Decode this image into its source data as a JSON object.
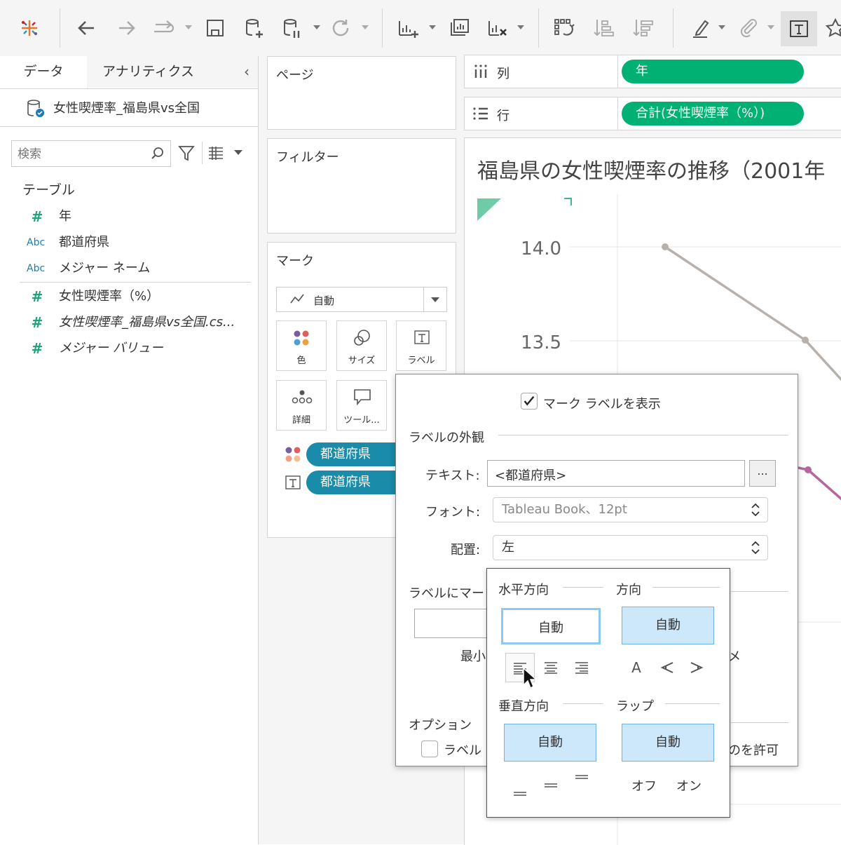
{
  "toolbar": {
    "icons": [
      "tableau-logo-icon",
      "back-icon",
      "forward-icon",
      "redo-icon",
      "save-icon",
      "new-datasource-icon",
      "pause-update-icon",
      "refresh-icon",
      "new-sheet-icon",
      "duplicate-sheet-icon",
      "clear-sheet-icon",
      "swap-icon",
      "sort-asc-icon",
      "sort-desc-icon",
      "highlight-icon",
      "attach-icon",
      "show-labels-icon",
      "pin-icon"
    ]
  },
  "datapane": {
    "tab_data": "データ",
    "tab_analytics": "アナリティクス",
    "datasource": "女性喫煙率_福島県vs全国",
    "search_placeholder": "検索",
    "section_table": "テーブル",
    "fields": [
      {
        "type": "#",
        "name": "年"
      },
      {
        "type": "Abc",
        "name": "都道府県"
      },
      {
        "type": "Abc",
        "name": "メジャー ネーム"
      },
      {
        "type": "#",
        "name": "女性喫煙率（%）"
      },
      {
        "type": "#",
        "name": "女性喫煙率_福島県vs全国.cs..."
      },
      {
        "type": "#",
        "name": "メジャー バリュー"
      }
    ]
  },
  "shelves": {
    "pages": "ページ",
    "filters": "フィルター",
    "marks": "マーク",
    "mark_type": "自動",
    "mark_buttons": [
      "色",
      "サイズ",
      "ラベル",
      "詳細",
      "ツール..."
    ],
    "mark_pills": [
      "都道府県",
      "都道府県"
    ],
    "columns_label": "列",
    "rows_label": "行",
    "columns_pill": "年",
    "rows_pill": "合計(女性喫煙率（%）)"
  },
  "chart": {
    "title": "福島県の女性喫煙率の推移（2001年",
    "yticks": [
      "14.0",
      "13.5"
    ]
  },
  "chart_data": {
    "type": "line",
    "title": "福島県の女性喫煙率の推移（2001年",
    "ytick_labels": [
      "14.0",
      "13.5"
    ],
    "series": [
      {
        "values": [
          14.0,
          13.5
        ],
        "color": "#b8b0aa"
      },
      {
        "values": [],
        "color": "#b5679d"
      }
    ]
  },
  "label_dialog": {
    "show_labels": "マーク ラベルを表示",
    "show_labels_checked": true,
    "section_appearance": "ラベルの外観",
    "text_label": "テキスト:",
    "text_value": "<都道府県>",
    "more_button": "...",
    "font_label": "フォント:",
    "font_value": "Tableau Book、12pt",
    "align_label": "配置:",
    "align_value": "左",
    "section_marks": "ラベルにマー",
    "min_label": "最小",
    "max_label_partial": "メ",
    "section_options": "オプション",
    "option_partial": "ラベル",
    "option_allow_partial": "のを許可"
  },
  "align_popup": {
    "horizontal": "水平方向",
    "direction": "方向",
    "vertical": "垂直方向",
    "wrap": "ラップ",
    "auto": "自動",
    "wrap_off": "オフ",
    "wrap_on": "オン",
    "direction_letter": "A"
  }
}
